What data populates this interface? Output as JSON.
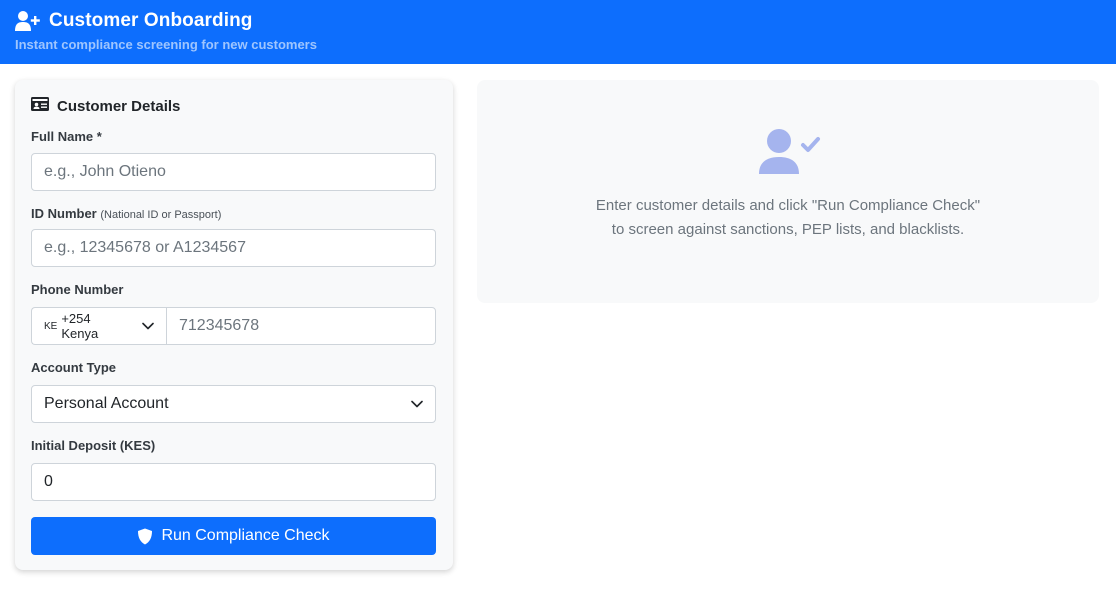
{
  "header": {
    "title": "Customer Onboarding",
    "subtitle": "Instant compliance screening for new customers",
    "icon": "user-plus-icon",
    "bg_color": "#0d6efd"
  },
  "form": {
    "title": "Customer Details",
    "icon": "id-card-icon",
    "full_name": {
      "label": "Full Name *",
      "placeholder": "e.g., John Otieno",
      "value": ""
    },
    "id_number": {
      "label": "ID Number",
      "hint": "(National ID or Passport)",
      "placeholder": "e.g., 12345678 or A1234567",
      "value": ""
    },
    "phone": {
      "label": "Phone Number",
      "country_flag": "KE",
      "country_label": "+254 Kenya",
      "placeholder": "712345678",
      "value": ""
    },
    "account_type": {
      "label": "Account Type",
      "selected": "Personal Account"
    },
    "initial_deposit": {
      "label": "Initial Deposit (KES)",
      "value": "0"
    },
    "submit_label": "Run Compliance Check",
    "submit_icon": "shield-icon"
  },
  "result": {
    "icon": "user-check-icon",
    "line1": "Enter customer details and click \"Run Compliance Check\"",
    "line2": "to screen against sanctions, PEP lists, and blacklists."
  }
}
